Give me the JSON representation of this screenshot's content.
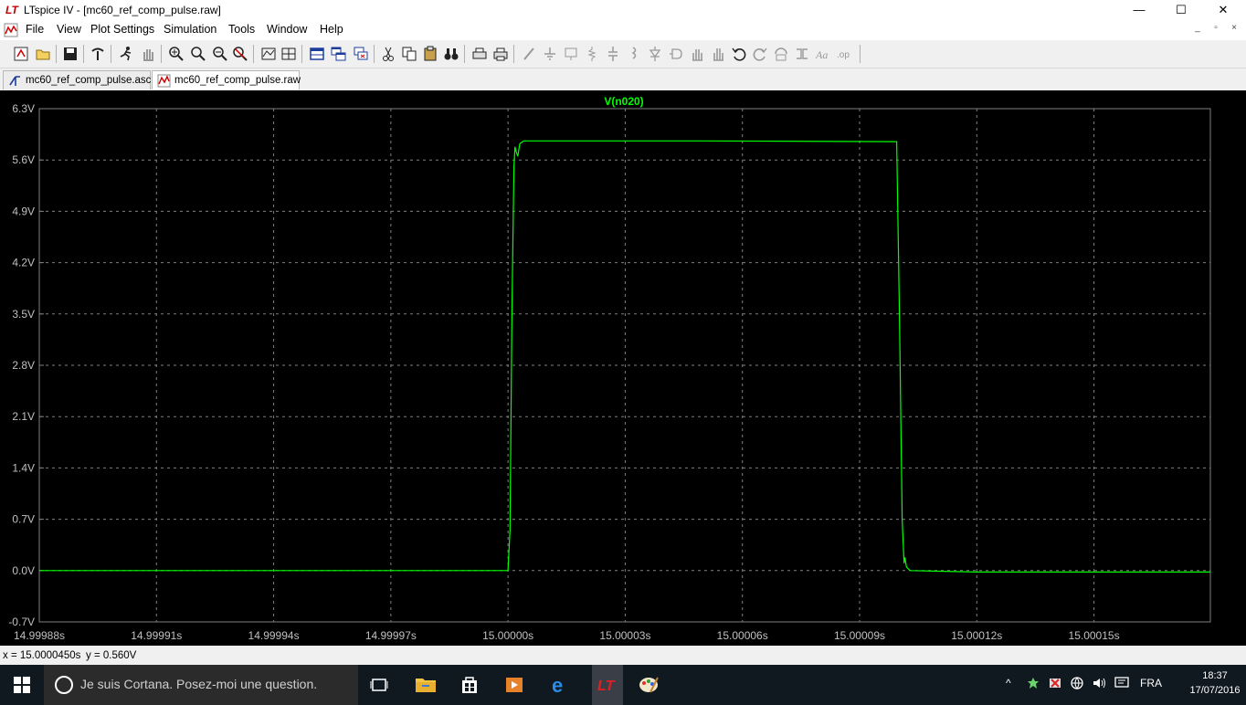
{
  "window": {
    "title": "LTspice IV - [mc60_ref_comp_pulse.raw]",
    "minimize": "—",
    "maximize": "☐",
    "close": "✕"
  },
  "menu": {
    "items": [
      "File",
      "View",
      "Plot Settings",
      "Simulation",
      "Tools",
      "Window",
      "Help"
    ],
    "mdi_minimize": "_",
    "mdi_restore": "▫",
    "mdi_close": "×"
  },
  "toolbar": {
    "icons": [
      "new-schematic-icon",
      "open-icon",
      "save-icon",
      "control-panel-icon",
      "run-icon",
      "halt-icon",
      "zoom-in-icon",
      "zoom-area-icon",
      "zoom-out-icon",
      "zoom-cancel-icon",
      "autorange-icon",
      "tile-vertical-icon",
      "cascade-icon",
      "tile-horizontal-icon",
      "cut-icon",
      "copy-icon",
      "paste-icon",
      "find-icon",
      "print-setup-icon",
      "print-icon",
      "wire-icon",
      "ground-icon",
      "label-icon",
      "resistor-icon",
      "capacitor-icon",
      "inductor-icon",
      "diode-icon",
      "component-icon",
      "move-icon",
      "drag-icon",
      "undo-icon",
      "redo-icon",
      "rotate-icon",
      "mirror-icon",
      "text-icon",
      "spice-directive-icon"
    ]
  },
  "tabs": [
    {
      "label": "mc60_ref_comp_pulse.asc",
      "icon": "schematic-tab-icon",
      "active": false
    },
    {
      "label": "mc60_ref_comp_pulse.raw",
      "icon": "waveform-tab-icon",
      "active": true
    }
  ],
  "colors": {
    "plot_bg": "#000000",
    "trace": "#00ff00",
    "grid": "#808080",
    "axis_text": "#c0c0c0",
    "trace_label": "#00ff00"
  },
  "chart_data": {
    "type": "line",
    "title": "",
    "series": [
      {
        "name": "V(n020)",
        "x": [
          14.99988,
          15.0,
          15.0000005,
          15.000001,
          15.0000015,
          15.0000018,
          15.000002,
          15.0000025,
          15.000003,
          15.000004,
          15.00005,
          15.0000995,
          15.0001002,
          15.0001009,
          15.0001014,
          15.0001016,
          15.000102,
          15.0001025,
          15.000103,
          15.00012,
          15.0001798
        ],
        "y": [
          0.0,
          0.0,
          0.55,
          3.5,
          5.5,
          5.78,
          5.73,
          5.65,
          5.82,
          5.86,
          5.86,
          5.85,
          3.5,
          0.7,
          0.1,
          0.18,
          0.05,
          0.02,
          0.0,
          -0.02,
          -0.02
        ]
      }
    ],
    "trace_label": "V(n020)",
    "yticks": [
      "6.3V",
      "5.6V",
      "4.9V",
      "4.2V",
      "3.5V",
      "2.8V",
      "2.1V",
      "1.4V",
      "0.7V",
      "0.0V",
      "-0.7V"
    ],
    "xticks": [
      "14.99988s",
      "14.99991s",
      "14.99994s",
      "14.99997s",
      "15.00000s",
      "15.00003s",
      "15.00006s",
      "15.00009s",
      "15.00012s",
      "15.00015s"
    ],
    "xlim": [
      14.99988,
      15.0001798
    ],
    "ylim": [
      -0.7,
      6.3
    ],
    "grid": true
  },
  "status": {
    "x_readout": "x = 15.0000450s",
    "y_readout": "y = 0.560V"
  },
  "taskbar": {
    "search_placeholder": "Je suis Cortana. Posez-moi une question.",
    "apps": [
      "task-view-icon",
      "file-explorer-icon",
      "store-icon",
      "media-player-icon",
      "edge-icon",
      "ltspice-icon",
      "paint-icon"
    ],
    "tray_lang": "FRA",
    "time": "18:37",
    "date": "17/07/2016"
  }
}
